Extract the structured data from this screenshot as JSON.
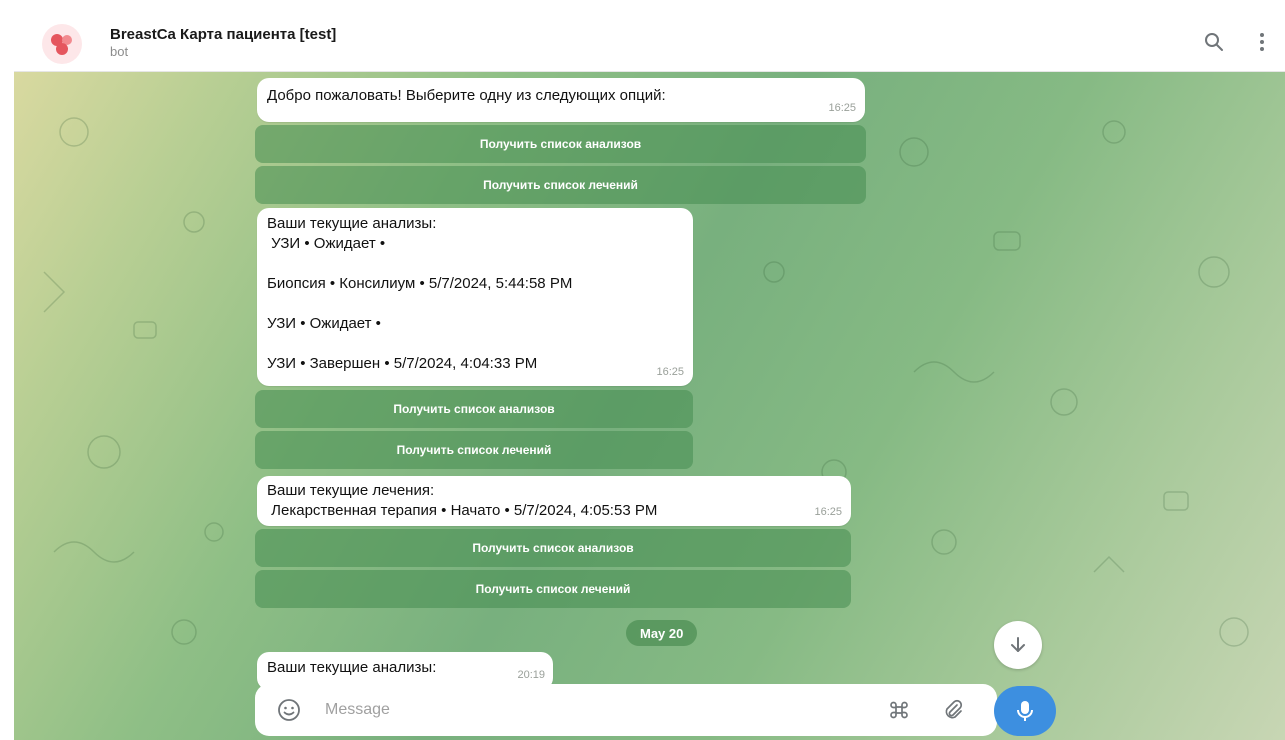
{
  "header": {
    "title": "BreastCa Карта пациента [test]",
    "subtitle": "bot",
    "accent_color": "#e5565e"
  },
  "messages": [
    {
      "lines": [
        "Добро пожаловать! Выберите одну из следующих опций:"
      ],
      "time": "16:25",
      "buttons": [
        "Получить список анализов",
        "Получить список лечений"
      ]
    },
    {
      "lines": [
        "Ваши текущие анализы:",
        " УЗИ • Ожидает •",
        "",
        "Биопсия • Консилиум • 5/7/2024, 5:44:58 PM",
        "",
        "УЗИ • Ожидает •",
        "",
        "УЗИ • Завершен • 5/7/2024, 4:04:33 PM"
      ],
      "time": "16:25",
      "buttons": [
        "Получить список анализов",
        "Получить список лечений"
      ]
    },
    {
      "lines": [
        "Ваши текущие лечения:",
        " Лекарственная терапия • Начато • 5/7/2024, 4:05:53 PM"
      ],
      "time": "16:25",
      "buttons": [
        "Получить список анализов",
        "Получить список лечений"
      ]
    },
    {
      "lines": [
        "Ваши текущие анализы:"
      ],
      "time": "20:19",
      "buttons": []
    }
  ],
  "date_separator": "May 20",
  "composer": {
    "placeholder": "Message"
  },
  "icons": {
    "header": [
      "search-icon",
      "more-vertical-icon"
    ],
    "composer": [
      "emoji-icon",
      "command-icon",
      "attach-icon",
      "microphone-icon"
    ],
    "scroll": "arrow-down-icon"
  },
  "colors": {
    "button_fill": "#5a9a64",
    "mic_button": "#3d8fe0"
  }
}
